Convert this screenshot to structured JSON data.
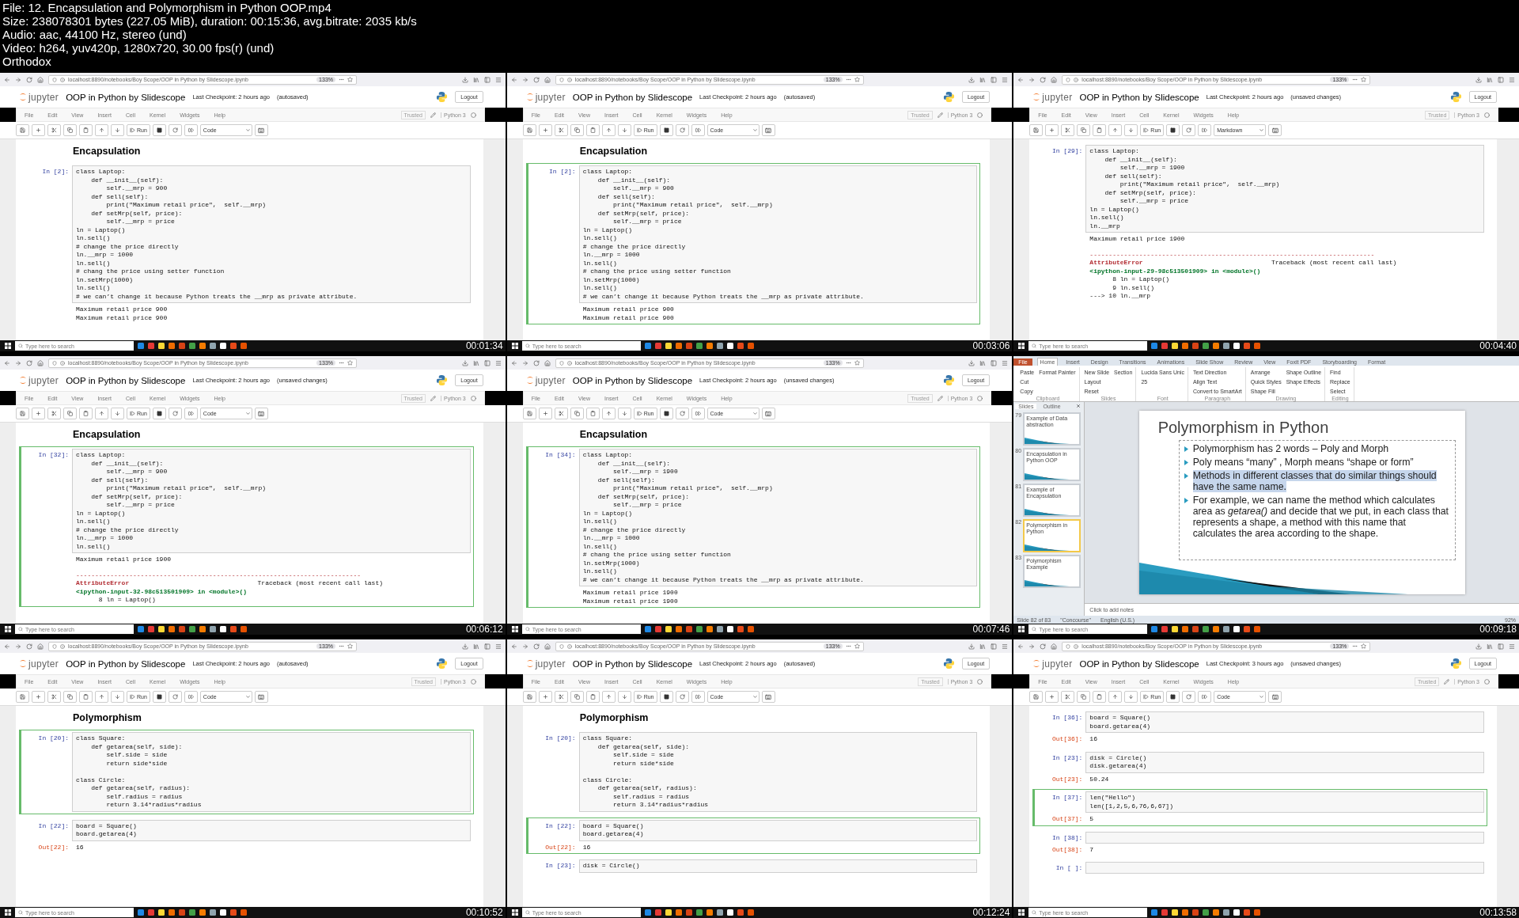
{
  "file_info": [
    "File: 12. Encapsulation and Polymorphism in Python OOP.mp4",
    "Size: 238078301 bytes (227.05 MiB), duration: 00:15:36, avg.bitrate: 2035 kb/s",
    "Audio: aac, 44100 Hz, stereo (und)",
    "Video: h264, yuv420p, 1280x720, 30.00 fps(r) (und)",
    "Orthodox"
  ],
  "frames": [
    {
      "kind": "notebook",
      "timestamp": "00:01:34",
      "url": "localhost:8890/notebooks/Boy Scope/OOP in Python by Slidescope.ipynb",
      "zoom": "133%",
      "logo": "jupyter",
      "title": "OOP in Python by Slidescope",
      "checkpoint": "Last Checkpoint: 2 hours ago",
      "save_status": "(autosaved)",
      "logout": "Logout",
      "menu": [
        "File",
        "Edit",
        "View",
        "Insert",
        "Cell",
        "Kernel",
        "Widgets",
        "Help"
      ],
      "trusted": "Trusted",
      "edit_mode": true,
      "kernel": "Python 3",
      "run": "Run",
      "cell_type": "Code",
      "search": "Type here to search",
      "cells": [
        {
          "kind": "heading",
          "text": "Encapsulation"
        },
        {
          "kind": "code",
          "prompt": "In [2]:",
          "selected": false,
          "code": "class Laptop:\n    def __init__(self):\n        self.__mrp = 900\n    def sell(self):\n        print(\"Maximum retail price\",  self.__mrp)\n    def setMrp(self, price):\n        self.__mrp = price\nln = Laptop()\nln.sell()\n# change the price directly\nln.__mrp = 1000\nln.sell()\n# chang the price using setter function\nln.setMrp(1000)\nln.sell()\n# we can’t change it because Python treats the __mrp as private attribute.",
          "outputs": [
            {
              "kind": "stream",
              "text": "Maximum retail price 900\nMaximum retail price 900"
            }
          ]
        }
      ]
    },
    {
      "kind": "notebook",
      "timestamp": "00:03:06",
      "url": "localhost:8890/notebooks/Boy Scope/OOP in Python by Slidescope.ipynb",
      "zoom": "133%",
      "logo": "jupyter",
      "title": "OOP in Python by Slidescope",
      "checkpoint": "Last Checkpoint: 2 hours ago",
      "save_status": "(autosaved)",
      "logout": "Logout",
      "menu": [
        "File",
        "Edit",
        "View",
        "Insert",
        "Cell",
        "Kernel",
        "Widgets",
        "Help"
      ],
      "trusted": "Trusted",
      "edit_mode": true,
      "kernel": "Python 3",
      "run": "Run",
      "cell_type": "Code",
      "search": "Type here to search",
      "cells": [
        {
          "kind": "heading",
          "text": "Encapsulation"
        },
        {
          "kind": "code",
          "prompt": "In [2]:",
          "selected": true,
          "code": "class Laptop:\n    def __init__(self):\n        self.__mrp = 900\n    def sell(self):\n        print(\"Maximum retail price\",  self.__mrp)\n    def setMrp(self, price):\n        self.__mrp = price\nln = Laptop()\nln.sell()\n# change the price directly\nln.__mrp = 1000\nln.sell()\n# chang the price using setter function\nln.setMrp(1000)\nln.sell()\n# we can’t change it because Python treats the __mrp as private attribute.",
          "outputs": [
            {
              "kind": "stream",
              "text": "Maximum retail price 900\nMaximum retail price 900"
            }
          ]
        }
      ]
    },
    {
      "kind": "notebook",
      "timestamp": "00:04:40",
      "url": "localhost:8890/notebooks/Boy Scope/OOP in Python by Slidescope.ipynb",
      "zoom": "133%",
      "logo": "jupyter",
      "title": "OOP in Python by Slidescope",
      "checkpoint": "Last Checkpoint: 2 hours ago",
      "save_status": "(unsaved changes)",
      "logout": "Logout",
      "menu": [
        "File",
        "Edit",
        "View",
        "Insert",
        "Cell",
        "Kernel",
        "Widgets",
        "Help"
      ],
      "trusted": "Trusted",
      "edit_mode": false,
      "kernel": "Python 3",
      "run": "Run",
      "cell_type": "Markdown",
      "search": "Type here to search",
      "cells": [
        {
          "kind": "code",
          "prompt": "In [29]:",
          "selected": false,
          "code": "class Laptop:\n    def __init__(self):\n        self.__mrp = 1900\n    def sell(self):\n        print(\"Maximum retail price\",  self.__mrp)\n    def setMrp(self, price):\n        self.__mrp = price\nln = Laptop()\nln.sell()\nln.__mrp",
          "outputs": [
            {
              "kind": "stream",
              "text": "Maximum retail price 1900"
            },
            {
              "kind": "error",
              "rule": "---------------------------------------------------------------------------",
              "name": "AttributeError",
              "traceback": "Traceback (most recent call last)",
              "location": "<ipython-input-29-98c513501909> in <module>()",
              "lines": "      8 ln = Laptop()\n      9 ln.sell()\n---> 10 ln.__mrp"
            }
          ]
        }
      ]
    },
    {
      "kind": "notebook",
      "timestamp": "00:06:12",
      "url": "localhost:8890/notebooks/Boy Scope/OOP in Python by Slidescope.ipynb",
      "zoom": "133%",
      "logo": "jupyter",
      "title": "OOP in Python by Slidescope",
      "checkpoint": "Last Checkpoint: 2 hours ago",
      "save_status": "(unsaved changes)",
      "logout": "Logout",
      "menu": [
        "File",
        "Edit",
        "View",
        "Insert",
        "Cell",
        "Kernel",
        "Widgets",
        "Help"
      ],
      "trusted": "Trusted",
      "edit_mode": true,
      "kernel": "Python 3",
      "run": "Run",
      "cell_type": "Code",
      "search": "Type here to search",
      "cells": [
        {
          "kind": "heading",
          "text": "Encapsulation"
        },
        {
          "kind": "code",
          "prompt": "In [32]:",
          "selected": true,
          "code": "class Laptop:\n    def __init__(self):\n        self.__mrp = 900\n    def sell(self):\n        print(\"Maximum retail price\",  self.__mrp)\n    def setMrp(self, price):\n        self.__mrp = price\nln = Laptop()\nln.sell()\n# change the price directly\nln.__mrp = 1000\nln.sell()",
          "outputs": [
            {
              "kind": "stream",
              "text": "Maximum retail price 1900"
            },
            {
              "kind": "error",
              "rule": "---------------------------------------------------------------------------",
              "name": "AttributeError",
              "traceback": "Traceback (most recent call last)",
              "location": "<ipython-input-32-98c513501909> in <module>()",
              "lines": "      8 ln = Laptop()"
            }
          ]
        }
      ]
    },
    {
      "kind": "notebook",
      "timestamp": "00:07:46",
      "url": "localhost:8890/notebooks/Boy Scope/OOP in Python by Slidescope.ipynb",
      "zoom": "133%",
      "logo": "jupyter",
      "title": "OOP in Python by Slidescope",
      "checkpoint": "Last Checkpoint: 2 hours ago",
      "save_status": "(unsaved changes)",
      "logout": "Logout",
      "menu": [
        "File",
        "Edit",
        "View",
        "Insert",
        "Cell",
        "Kernel",
        "Widgets",
        "Help"
      ],
      "trusted": "Trusted",
      "edit_mode": true,
      "kernel": "Python 3",
      "run": "Run",
      "cell_type": "Code",
      "search": "Type here to search",
      "cells": [
        {
          "kind": "heading",
          "text": "Encapsulation"
        },
        {
          "kind": "code",
          "prompt": "In [34]:",
          "selected": true,
          "code": "class Laptop:\n    def __init__(self):\n        self.__mrp = 1900\n    def sell(self):\n        print(\"Maximum retail price\",  self.__mrp)\n    def setMrp(self, price):\n        self.__mrp = price\nln = Laptop()\nln.sell()\n# change the price directly\nln.__mrp = 1000\nln.sell()\n# chang the price using setter function\nln.setMrp(1000)\nln.sell()\n# we can’t change it because Python treats the __mrp as private attribute.",
          "outputs": [
            {
              "kind": "stream",
              "text": "Maximum retail price 1900\nMaximum retail price 1900"
            }
          ]
        }
      ]
    },
    {
      "kind": "slides",
      "timestamp": "00:09:18",
      "file_tab": "File",
      "ribbon_tabs": [
        {
          "label": "Home",
          "selected": true
        },
        {
          "label": "Insert",
          "selected": false
        },
        {
          "label": "Design",
          "selected": false
        },
        {
          "label": "Transitions",
          "selected": false
        },
        {
          "label": "Animations",
          "selected": false
        },
        {
          "label": "Slide Show",
          "selected": false
        },
        {
          "label": "Review",
          "selected": false
        },
        {
          "label": "View",
          "selected": false
        },
        {
          "label": "Foxit PDF",
          "selected": false
        },
        {
          "label": "Storyboarding",
          "selected": false
        },
        {
          "label": "Format",
          "selected": false
        }
      ],
      "ribbon_groups": [
        {
          "label": "Clipboard",
          "items": [
            "Paste",
            "Cut",
            "Copy",
            "Format Painter"
          ]
        },
        {
          "label": "Slides",
          "items": [
            "New Slide",
            "Layout",
            "Reset",
            "Section"
          ]
        },
        {
          "label": "Font",
          "items": [
            "Lucida Sans Unic",
            "25"
          ]
        },
        {
          "label": "Paragraph",
          "items": [
            "Text Direction",
            "Align Text",
            "Convert to SmartArt"
          ]
        },
        {
          "label": "Drawing",
          "items": [
            "Arrange",
            "Quick Styles",
            "Shape Fill",
            "Shape Outline",
            "Shape Effects"
          ]
        },
        {
          "label": "Editing",
          "items": [
            "Find",
            "Replace",
            "Select"
          ]
        }
      ],
      "panel_tabs": [
        {
          "label": "Slides",
          "selected": true
        },
        {
          "label": "Outline",
          "selected": false
        }
      ],
      "thumbnails": [
        {
          "number": "79",
          "title": "Example of Data abstraction",
          "selected": false
        },
        {
          "number": "80",
          "title": "Encapsulation in Python OOP",
          "selected": false
        },
        {
          "number": "81",
          "title": "Example of Encapsulation",
          "selected": false
        },
        {
          "number": "82",
          "title": "Polymorphism in Python",
          "selected": true
        },
        {
          "number": "83",
          "title": "Polymorphism Example",
          "selected": false
        }
      ],
      "slide": {
        "title": "Polymorphism in Python",
        "bullets": [
          {
            "text": "Polymorphism has 2 words – Poly and Morph",
            "highlighted": false
          },
          {
            "text": "Poly means “many” , Morph means “shape or form”",
            "highlighted": false
          },
          {
            "text": "Methods in different classes that do similar things should have the same name.",
            "highlighted": true
          },
          {
            "text": "For example, we can name the method which calculates area as *getarea()* and decide that we put, in each class that represents a shape, a method with this name that calculates the area according to the shape.",
            "highlighted": false
          }
        ]
      },
      "notes_placeholder": "Click to add notes",
      "status": [
        "Slide 82 of 83",
        "\"Concourse\"",
        "English (U.S.)"
      ],
      "zoom_level": "92%",
      "search": "Type here to search"
    },
    {
      "kind": "notebook",
      "timestamp": "00:10:52",
      "url": "localhost:8890/notebooks/Boy Scope/OOP in Python by Slidescope.ipynb",
      "zoom": "133%",
      "logo": "jupyter",
      "title": "OOP in Python by Slidescope",
      "checkpoint": "Last Checkpoint: 2 hours ago",
      "save_status": "(autosaved)",
      "logout": "Logout",
      "menu": [
        "File",
        "Edit",
        "View",
        "Insert",
        "Cell",
        "Kernel",
        "Widgets",
        "Help"
      ],
      "trusted": "Trusted",
      "edit_mode": false,
      "kernel": "Python 3",
      "run": "Run",
      "cell_type": "Code",
      "search": "Type here to search",
      "cells": [
        {
          "kind": "heading",
          "text": "Polymorphism"
        },
        {
          "kind": "code",
          "prompt": "In [20]:",
          "selected": true,
          "code": "class Square:\n    def getarea(self, side):\n        self.side = side\n        return side*side\n\nclass Circle:\n    def getarea(self, radius):\n        self.radius = radius\n        return 3.14*radius*radius"
        },
        {
          "kind": "code",
          "prompt": "In [22]:",
          "selected": false,
          "code": "board = Square()\nboard.getarea(4)",
          "outputs": [
            {
              "kind": "result",
              "prompt": "Out[22]:",
              "text": "16"
            }
          ]
        }
      ]
    },
    {
      "kind": "notebook",
      "timestamp": "00:12:24",
      "url": "localhost:8890/notebooks/Boy Scope/OOP in Python by Slidescope.ipynb",
      "zoom": "133%",
      "logo": "jupyter",
      "title": "OOP in Python by Slidescope",
      "checkpoint": "Last Checkpoint: 2 hours ago",
      "save_status": "(autosaved)",
      "logout": "Logout",
      "menu": [
        "File",
        "Edit",
        "View",
        "Insert",
        "Cell",
        "Kernel",
        "Widgets",
        "Help"
      ],
      "trusted": "Trusted",
      "edit_mode": false,
      "kernel": "Python 3",
      "run": "Run",
      "cell_type": "Code",
      "search": "Type here to search",
      "cells": [
        {
          "kind": "heading",
          "text": "Polymorphism"
        },
        {
          "kind": "code",
          "prompt": "In [20]:",
          "selected": false,
          "code": "class Square:\n    def getarea(self, side):\n        self.side = side\n        return side*side\n\nclass Circle:\n    def getarea(self, radius):\n        self.radius = radius\n        return 3.14*radius*radius"
        },
        {
          "kind": "code",
          "prompt": "In [22]:",
          "selected": true,
          "code": "board = Square()\nboard.getarea(4)",
          "outputs": [
            {
              "kind": "result",
              "prompt": "Out[22]:",
              "text": "16"
            }
          ]
        },
        {
          "kind": "code",
          "prompt": "In [23]:",
          "selected": false,
          "code": "disk = Circle()"
        }
      ]
    },
    {
      "kind": "notebook",
      "timestamp": "00:13:58",
      "url": "localhost:8890/notebooks/Boy Scope/OOP in Python by Slidescope.ipynb",
      "zoom": "133%",
      "logo": "jupyter",
      "title": "OOP in Python by Slidescope",
      "checkpoint": "Last Checkpoint: 3 hours ago",
      "save_status": "(unsaved changes)",
      "logout": "Logout",
      "menu": [
        "File",
        "Edit",
        "View",
        "Insert",
        "Cell",
        "Kernel",
        "Widgets",
        "Help"
      ],
      "trusted": "Trusted",
      "edit_mode": true,
      "kernel": "Python 3",
      "run": "Run",
      "cell_type": "Code",
      "search": "Type here to search",
      "cells": [
        {
          "kind": "code",
          "prompt": "In [36]:",
          "selected": false,
          "code": "board = Square()\nboard.getarea(4)",
          "outputs": [
            {
              "kind": "result",
              "prompt": "Out[36]:",
              "text": "16"
            }
          ]
        },
        {
          "kind": "code",
          "prompt": "In [23]:",
          "selected": false,
          "code": "disk = Circle()\ndisk.getarea(4)",
          "outputs": [
            {
              "kind": "result",
              "prompt": "Out[23]:",
              "text": "50.24"
            }
          ]
        },
        {
          "kind": "code",
          "prompt": "In [37]:",
          "selected": true,
          "code": "len(\"Hello\")\nlen([1,2,5,6,76,6,67])",
          "outputs": [
            {
              "kind": "result",
              "prompt": "Out[37]:",
              "text": "5"
            }
          ]
        },
        {
          "kind": "code",
          "prompt": "In [38]:",
          "selected": false,
          "outputs": [
            {
              "kind": "result",
              "prompt": "Out[38]:",
              "text": "7"
            }
          ]
        },
        {
          "kind": "code",
          "prompt": "In [ ]:",
          "selected": false
        }
      ]
    }
  ]
}
